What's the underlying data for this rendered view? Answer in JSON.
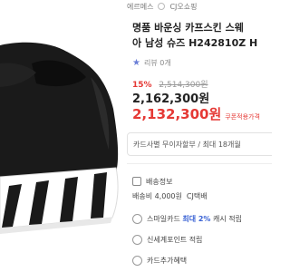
{
  "top": {
    "tags": [
      "에르메스",
      "CJ오쇼핑"
    ]
  },
  "product": {
    "title_line1": "명품 바운싱 카프스킨 스웨",
    "title_line2": "아 남성 슈즈 H242810Z H"
  },
  "review": {
    "star": "★",
    "label": "리뷰 0개"
  },
  "pricing": {
    "discount": "15%",
    "original": "2,514,300원",
    "sale": "2,162,300원",
    "coupon_price": "2,132,300원",
    "coupon_label": "쿠폰적용가격"
  },
  "card": {
    "text": "카드사별 무이자할부 / 최대 18개월"
  },
  "shipping": {
    "label": "배송정보",
    "fee": "배송비 4,000원",
    "carrier": "CJ택배"
  },
  "perks": [
    {
      "prefix": "스마일카드 ",
      "highlight": "최대 2%",
      "suffix": " 캐시 적립"
    },
    {
      "prefix": "신세계포인트 적립",
      "highlight": "",
      "suffix": ""
    },
    {
      "prefix": "카드추가혜택",
      "highlight": "",
      "suffix": ""
    }
  ],
  "colors": {
    "accent_red": "#e53935",
    "accent_blue": "#3b63d4",
    "shoe": "#1a1a1a",
    "sole": "#ffffff"
  }
}
